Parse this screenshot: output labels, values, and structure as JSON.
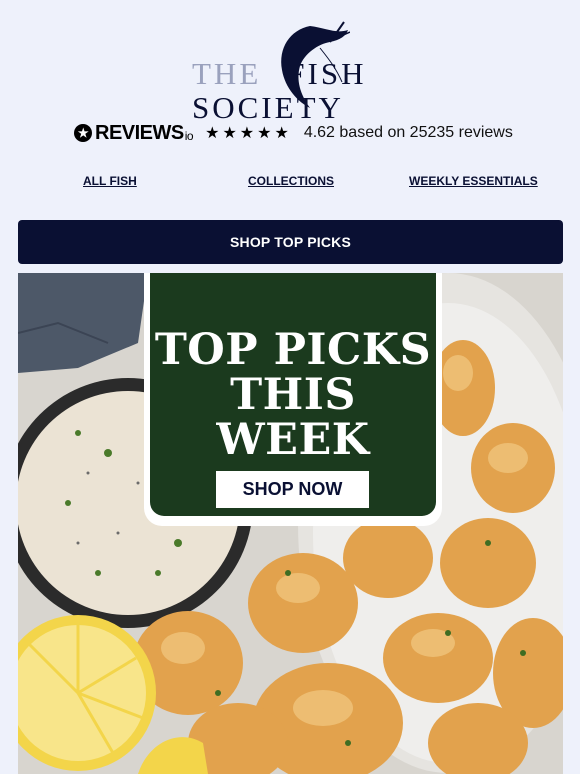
{
  "brand": {
    "line1_pre": "THE",
    "line1_post": "FISH",
    "line2": "SOCIETY",
    "logo_icon": "shrimp-icon"
  },
  "reviews": {
    "logo_text": "REVIEWS",
    "logo_suffix": "io",
    "stars": "★★★★★",
    "summary": "4.62 based on 25235 reviews",
    "rating": 4.62,
    "count": 25235
  },
  "nav": {
    "items": [
      {
        "label": "ALL FISH"
      },
      {
        "label": "COLLECTIONS"
      },
      {
        "label": "WEEKLY ESSENTIALS"
      }
    ]
  },
  "cta": {
    "label": "SHOP TOP PICKS"
  },
  "hero": {
    "title_line1": "TOP PICKS",
    "title_line2": "THIS WEEK",
    "button_label": "SHOP NOW"
  },
  "colors": {
    "navy": "#0a1033",
    "background": "#eef1fb",
    "card_green": "#1b3a1e"
  }
}
